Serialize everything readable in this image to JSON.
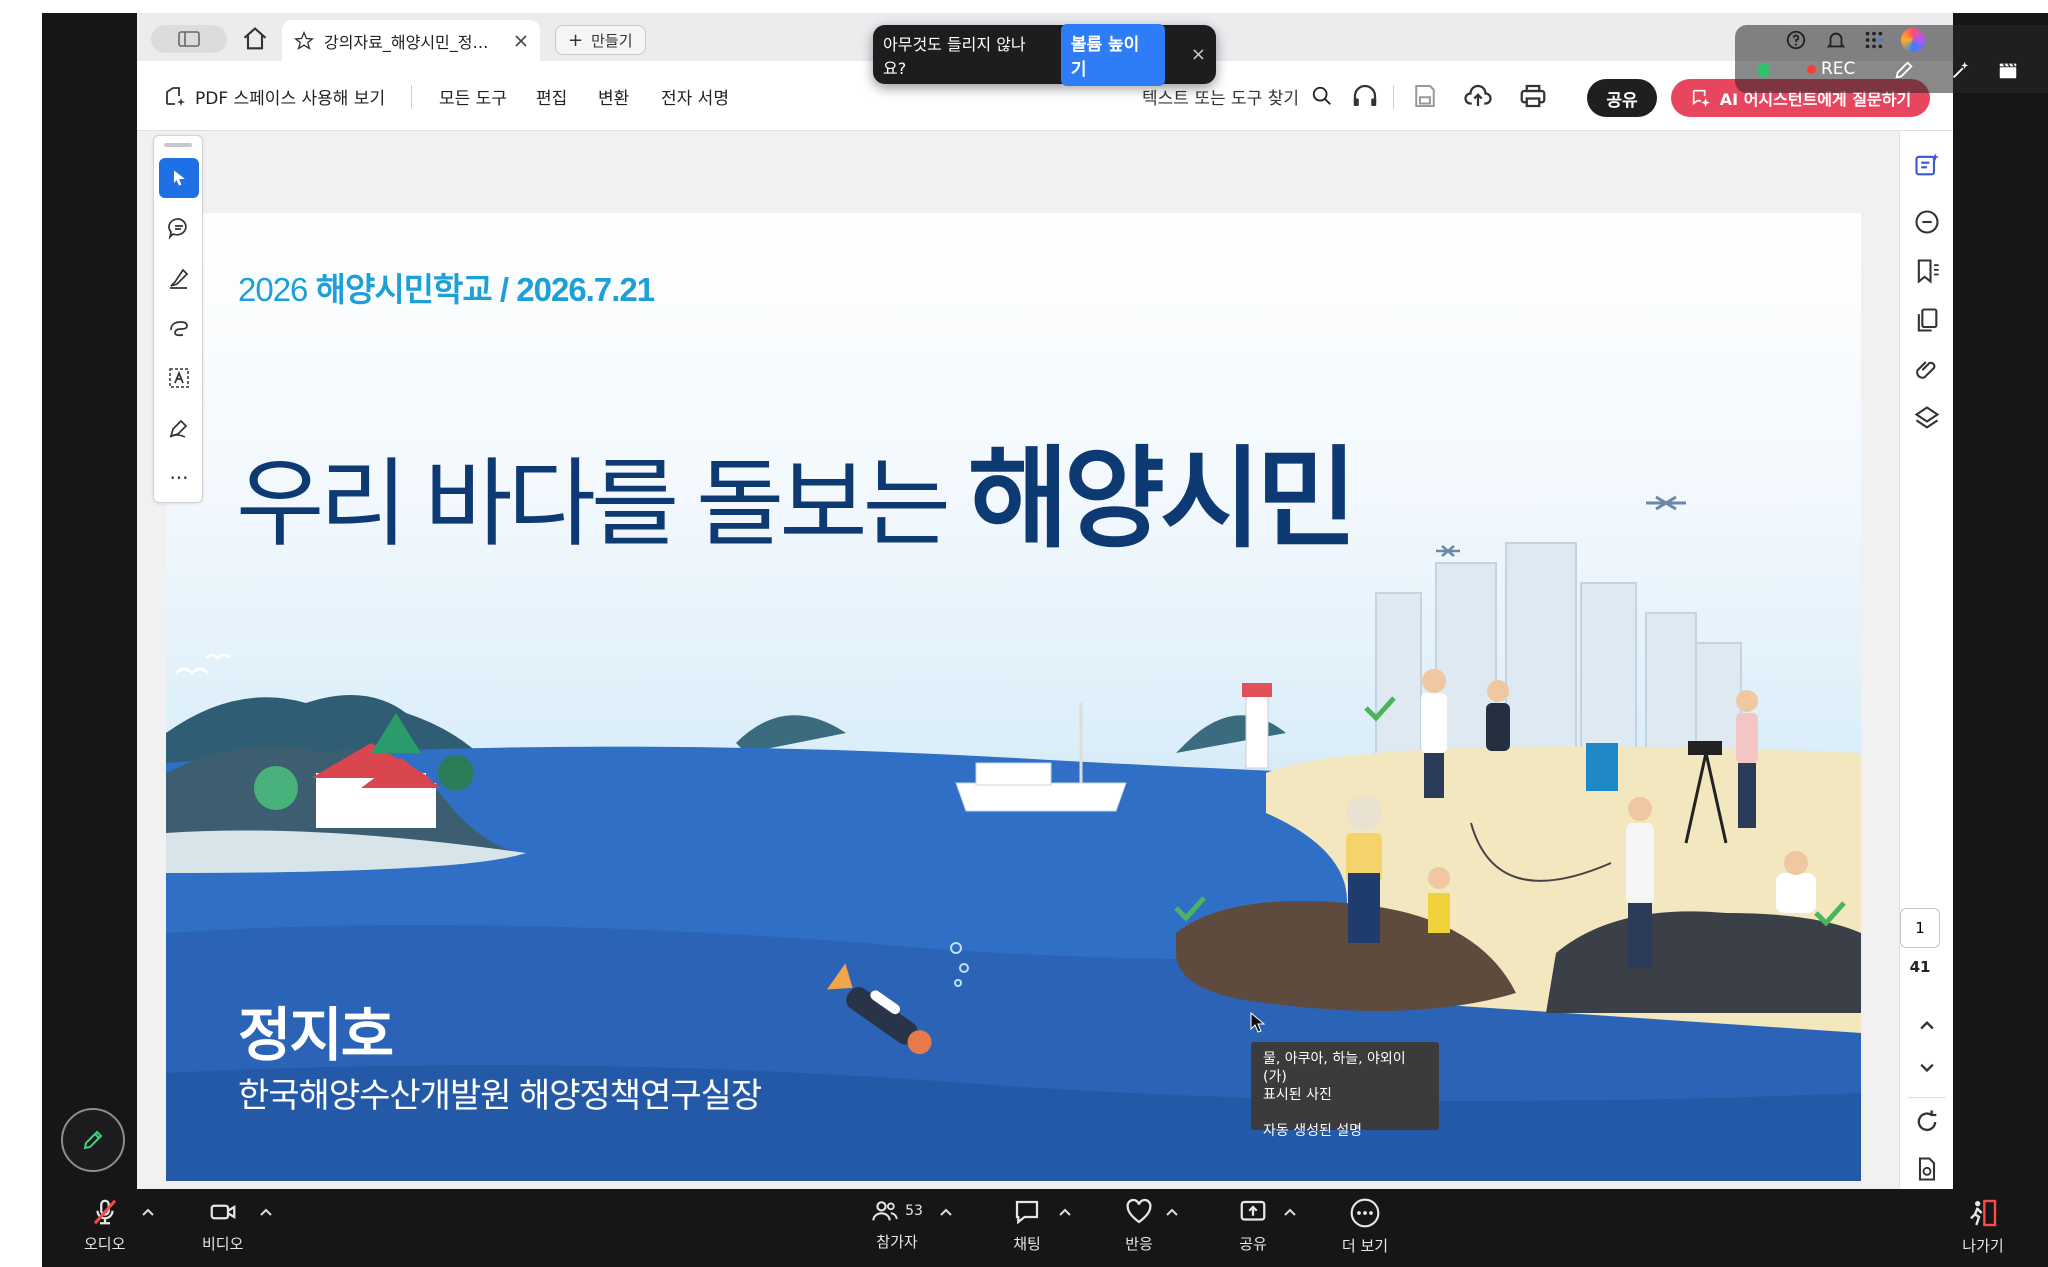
{
  "browser": {
    "tab_title": "강의자료_해양시민_정…",
    "new_tab_label": "만들기"
  },
  "toolbar": {
    "pdf_space": "PDF 스페이스 사용해 보기",
    "all_tools": "모든 도구",
    "edit": "편집",
    "convert": "변환",
    "esign": "전자 서명",
    "search_placeholder": "텍스트 또는 도구 찾기",
    "share": "공유",
    "ai_assistant": "AI 어시스턴트에게 질문하기"
  },
  "notification": {
    "message": "아무것도 들리지 않나요?",
    "button": "볼륨 높이기",
    "close": "×"
  },
  "recording": {
    "label": "REC"
  },
  "slide": {
    "date_prefix": "2026 ",
    "date_bold": "해양시민학교 / 2026.7.21",
    "title_light": "우리 바다를 돌보는 ",
    "title_bold": "해양시민",
    "presenter": "정지호",
    "organization": "한국해양수산개발원 해양정책연구실장"
  },
  "tooltip": {
    "line1": "물, 아쿠아, 하늘, 야외이(가)",
    "line2": "표시된 사진",
    "line3": "자동 생성된 설명"
  },
  "page_nav": {
    "current": "1",
    "total": "41"
  },
  "meeting_bar": {
    "audio": "오디오",
    "video": "비디오",
    "participants": "참가자",
    "participant_count": "53",
    "chat": "채팅",
    "reactions": "반응",
    "share": "공유",
    "more": "더 보기",
    "leave": "나가기"
  },
  "colors": {
    "accent_blue": "#2e7cf6",
    "ai_red": "#e8455e",
    "title_navy": "#0e3a74",
    "date_cyan": "#1da0d8",
    "sea_blue": "#2f6fc6"
  }
}
